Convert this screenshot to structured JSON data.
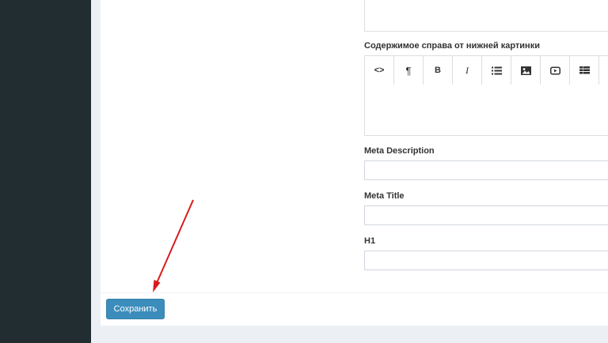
{
  "form": {
    "right_content_label": "Содержимое справа от нижней картинки",
    "toolbar": [
      {
        "icon": "code-icon",
        "text": "<>"
      },
      {
        "icon": "paragraph-icon",
        "text": "¶"
      },
      {
        "icon": "bold-icon",
        "text": "B"
      },
      {
        "icon": "italic-icon",
        "text": "I"
      },
      {
        "icon": "list-icon",
        "text": ""
      },
      {
        "icon": "image-icon",
        "text": ""
      },
      {
        "icon": "video-icon",
        "text": ""
      },
      {
        "icon": "table-icon",
        "text": ""
      }
    ],
    "meta_description_label": "Meta Description",
    "meta_description_value": "",
    "meta_title_label": "Meta Title",
    "meta_title_value": "",
    "h1_label": "H1",
    "h1_value": ""
  },
  "footer": {
    "save_label": "Сохранить"
  },
  "colors": {
    "sidebar": "#222d32",
    "primary": "#3c8dbc",
    "annotation_arrow": "#d81b1b"
  }
}
